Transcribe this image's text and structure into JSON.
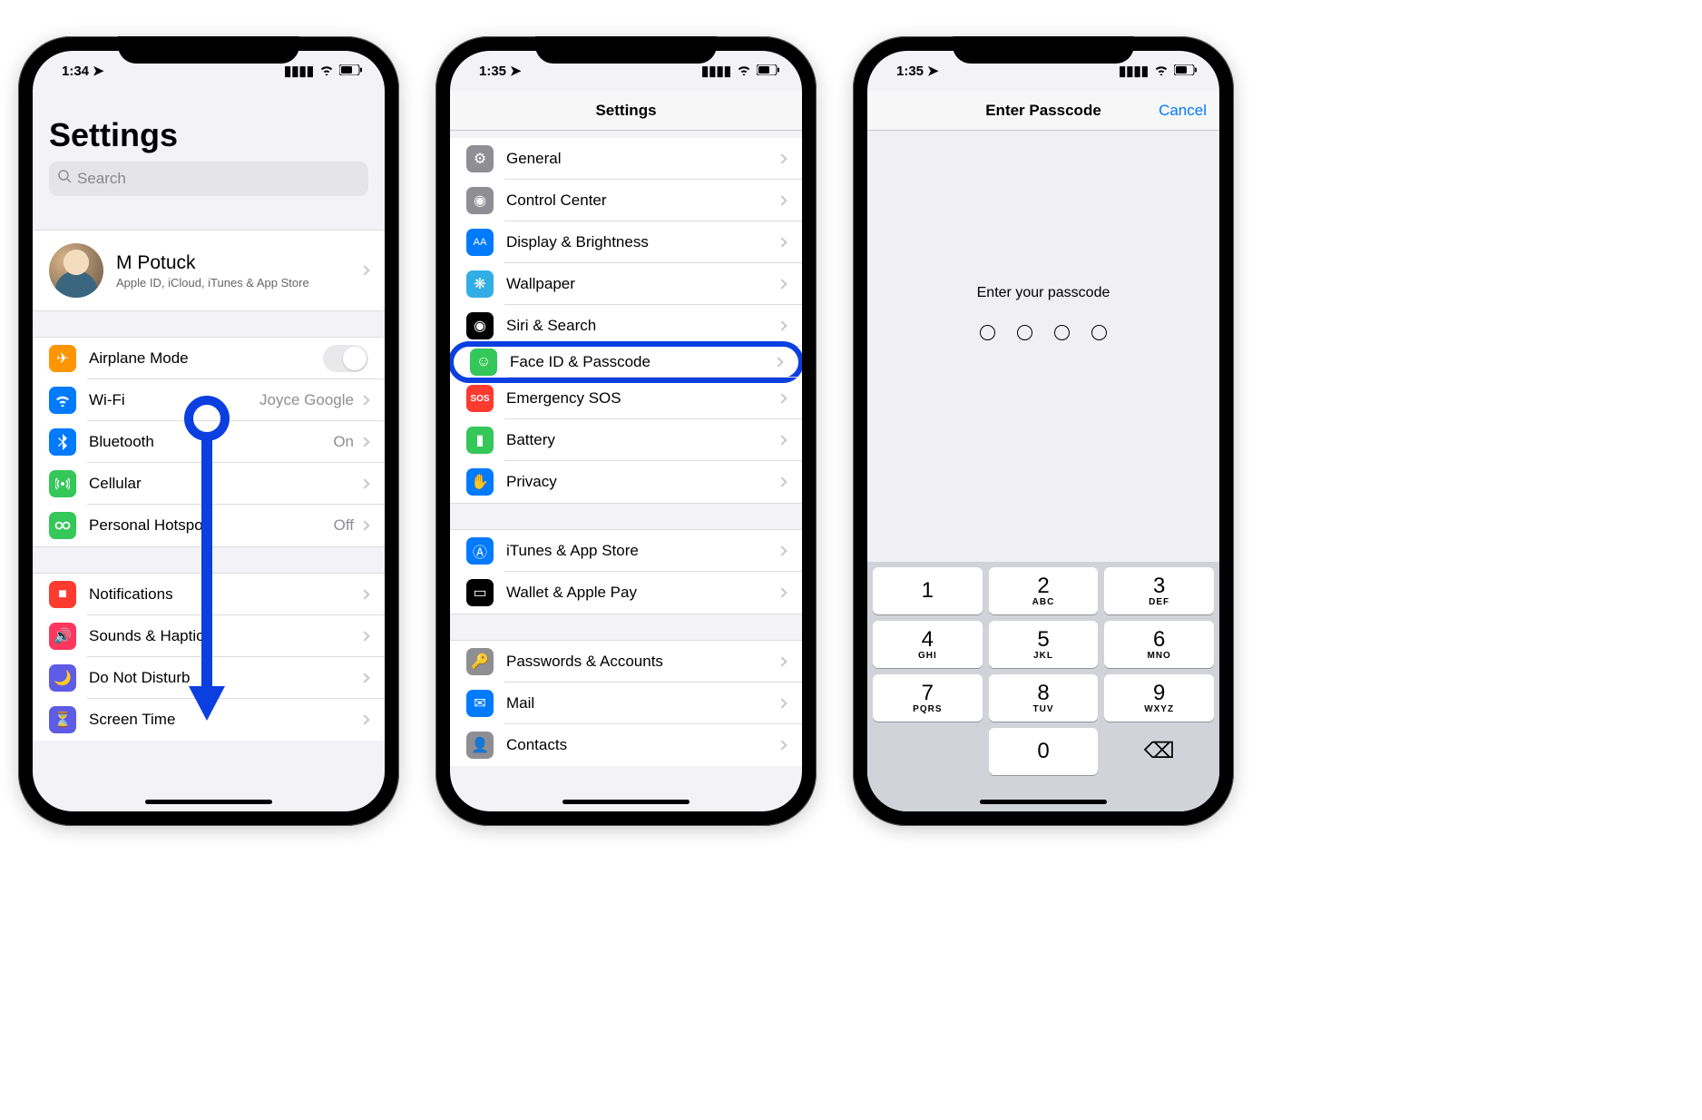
{
  "screens": {
    "s1": {
      "time": "1:34",
      "title": "Settings",
      "search_placeholder": "Search",
      "profile": {
        "name": "M Potuck",
        "sub": "Apple ID, iCloud, iTunes & App Store"
      },
      "rows": {
        "airplane": {
          "label": "Airplane Mode"
        },
        "wifi": {
          "label": "Wi-Fi",
          "value": "Joyce Google"
        },
        "bluetooth": {
          "label": "Bluetooth",
          "value": "On"
        },
        "cellular": {
          "label": "Cellular"
        },
        "hotspot": {
          "label": "Personal Hotspot",
          "value": "Off"
        },
        "notifications": {
          "label": "Notifications"
        },
        "sounds": {
          "label": "Sounds & Haptics"
        },
        "dnd": {
          "label": "Do Not Disturb"
        },
        "screentime": {
          "label": "Screen Time"
        }
      }
    },
    "s2": {
      "time": "1:35",
      "nav_title": "Settings",
      "rows": {
        "general": {
          "label": "General"
        },
        "control": {
          "label": "Control Center"
        },
        "display": {
          "label": "Display & Brightness"
        },
        "wallpaper": {
          "label": "Wallpaper"
        },
        "siri": {
          "label": "Siri & Search"
        },
        "faceid": {
          "label": "Face ID & Passcode"
        },
        "sos": {
          "label": "Emergency SOS"
        },
        "battery": {
          "label": "Battery"
        },
        "privacy": {
          "label": "Privacy"
        },
        "itunes": {
          "label": "iTunes & App Store"
        },
        "wallet": {
          "label": "Wallet & Apple Pay"
        },
        "passwords": {
          "label": "Passwords & Accounts"
        },
        "mail": {
          "label": "Mail"
        },
        "contacts": {
          "label": "Contacts"
        }
      }
    },
    "s3": {
      "time": "1:35",
      "nav_title": "Enter Passcode",
      "cancel": "Cancel",
      "prompt": "Enter your passcode",
      "keypad": [
        {
          "num": "1",
          "letters": ""
        },
        {
          "num": "2",
          "letters": "ABC"
        },
        {
          "num": "3",
          "letters": "DEF"
        },
        {
          "num": "4",
          "letters": "GHI"
        },
        {
          "num": "5",
          "letters": "JKL"
        },
        {
          "num": "6",
          "letters": "MNO"
        },
        {
          "num": "7",
          "letters": "PQRS"
        },
        {
          "num": "8",
          "letters": "TUV"
        },
        {
          "num": "9",
          "letters": "WXYZ"
        },
        {
          "num": "",
          "letters": ""
        },
        {
          "num": "0",
          "letters": ""
        },
        {
          "num": "⌫",
          "letters": ""
        }
      ]
    }
  },
  "colors": {
    "accent_blue": "#007aff",
    "highlight_blue": "#0b3fe0"
  }
}
